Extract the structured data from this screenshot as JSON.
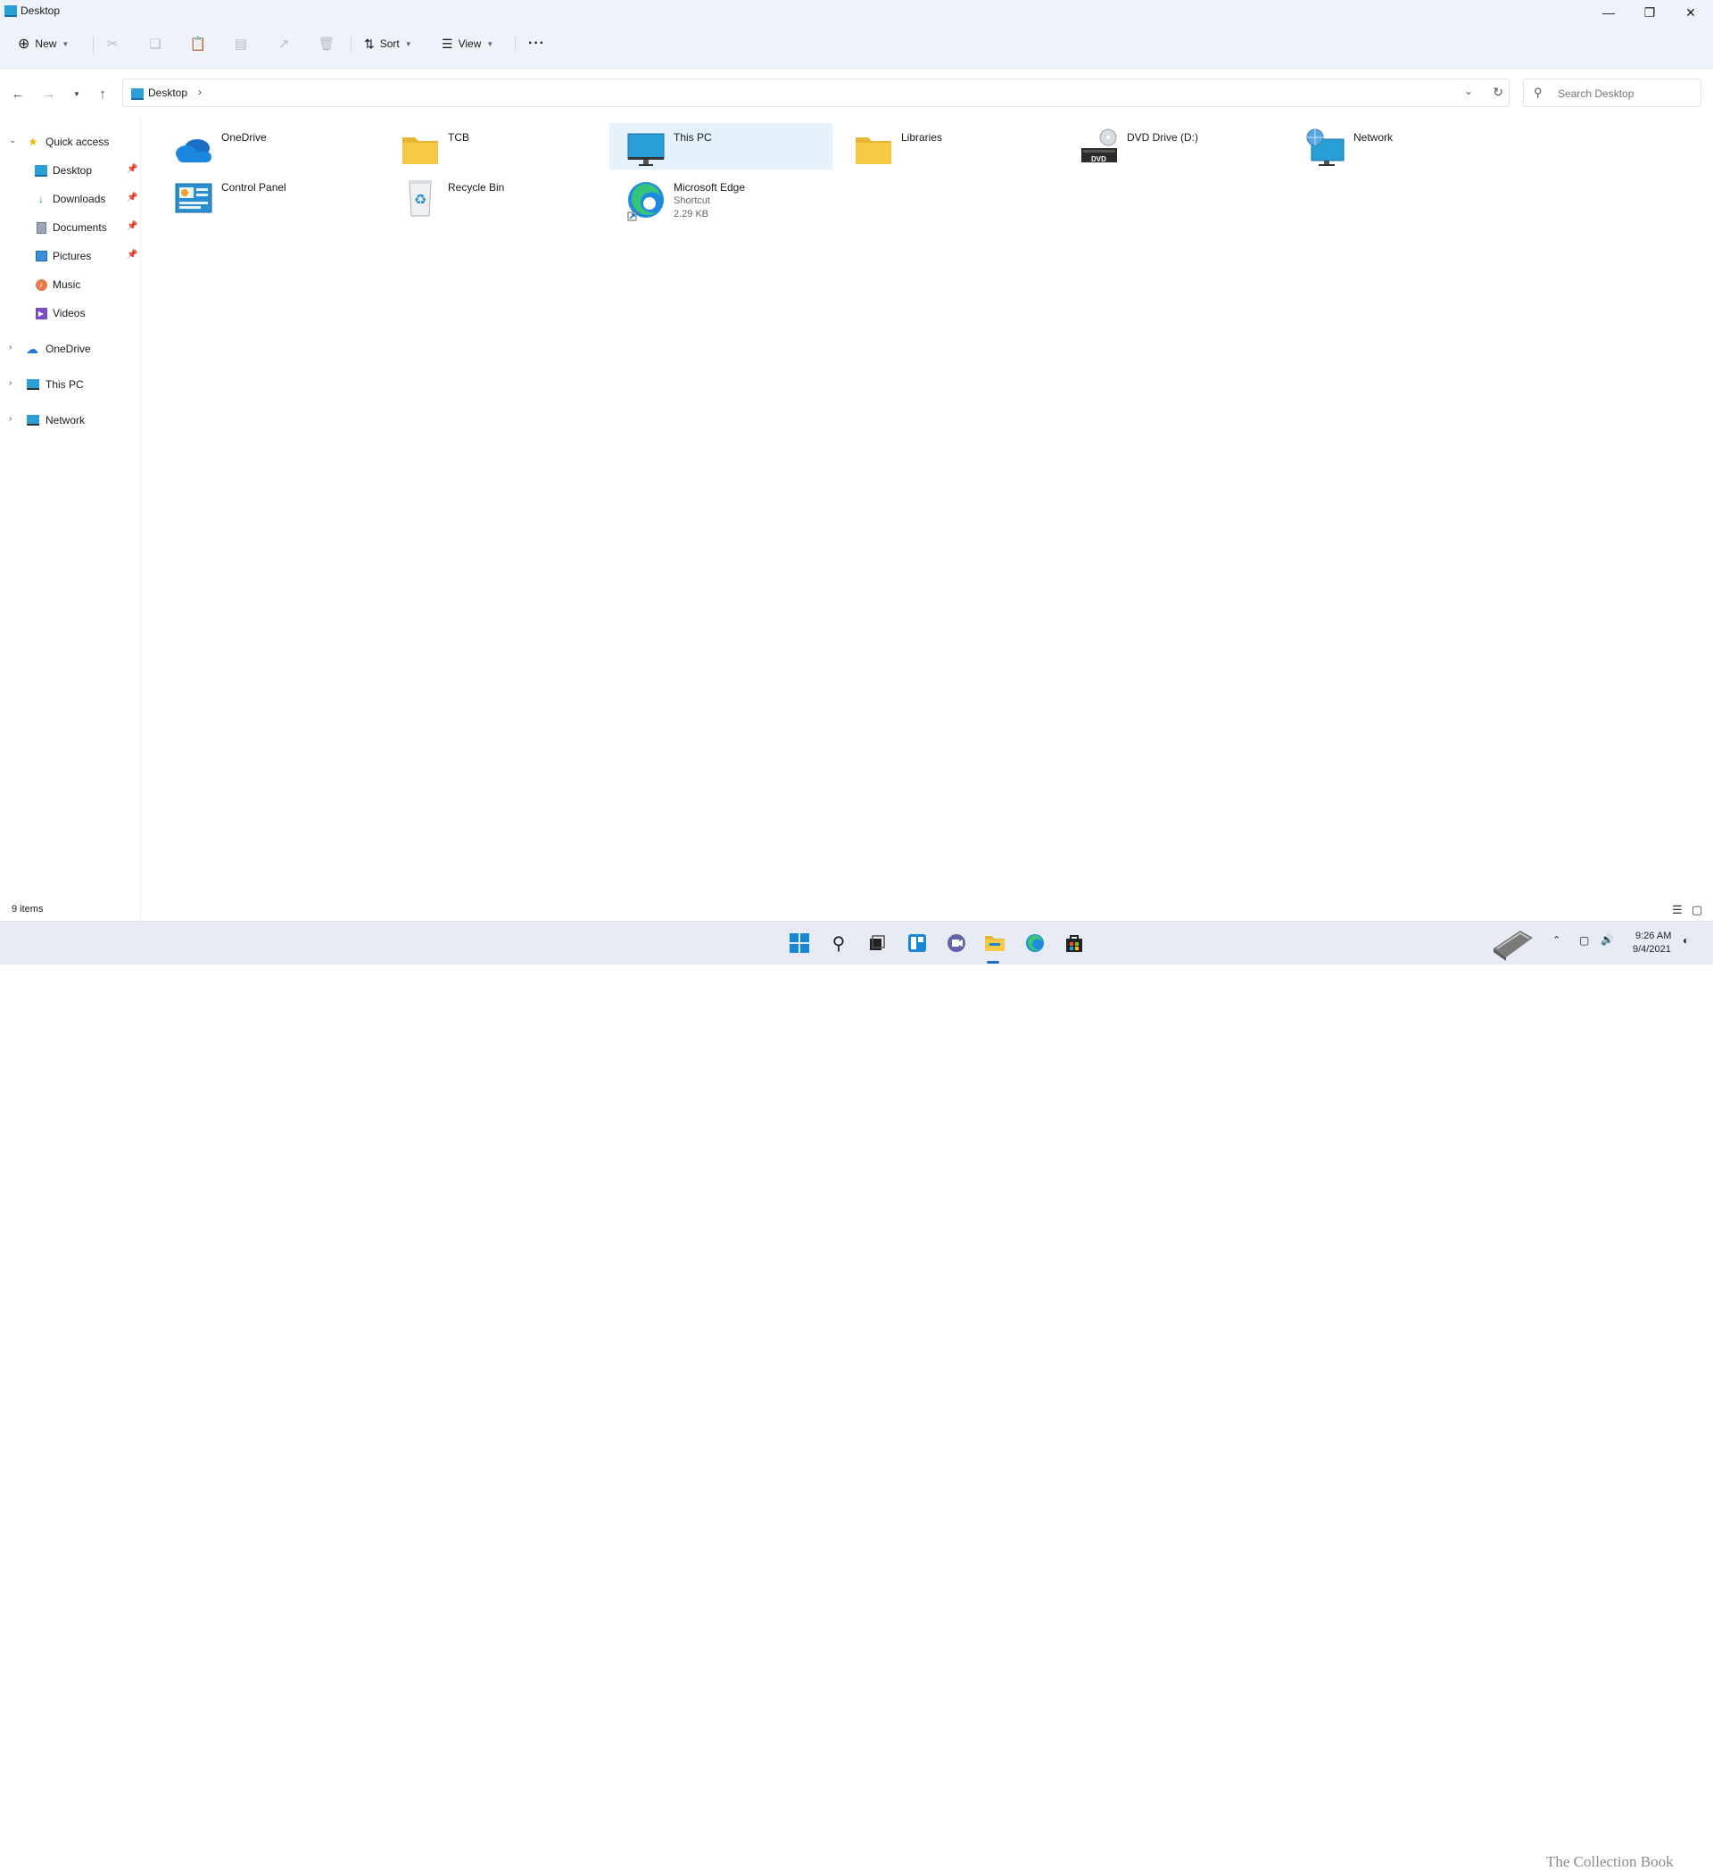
{
  "window": {
    "title": "Desktop"
  },
  "toolbar": {
    "new_label": "New",
    "sort_label": "Sort",
    "view_label": "View",
    "more_label": "···"
  },
  "address": {
    "location": "Desktop",
    "separator": "›"
  },
  "search": {
    "placeholder": "Search Desktop"
  },
  "sidebar": {
    "quick_access": {
      "label": "Quick access",
      "items": [
        {
          "label": "Desktop",
          "icon": "desktop-icon",
          "pinned": true
        },
        {
          "label": "Downloads",
          "icon": "downloads-icon",
          "pinned": true
        },
        {
          "label": "Documents",
          "icon": "documents-icon",
          "pinned": true
        },
        {
          "label": "Pictures",
          "icon": "pictures-icon",
          "pinned": true
        },
        {
          "label": "Music",
          "icon": "music-icon",
          "pinned": false
        },
        {
          "label": "Videos",
          "icon": "videos-icon",
          "pinned": false
        }
      ]
    },
    "roots": [
      {
        "label": "OneDrive",
        "icon": "onedrive-icon"
      },
      {
        "label": "This PC",
        "icon": "this-pc-icon"
      },
      {
        "label": "Network",
        "icon": "network-icon"
      }
    ]
  },
  "content": {
    "items": [
      {
        "name": "OneDrive",
        "icon": "onedrive-cloud-icon"
      },
      {
        "name": "TCB",
        "icon": "folder-icon"
      },
      {
        "name": "This PC",
        "icon": "monitor-icon",
        "selected": true
      },
      {
        "name": "Libraries",
        "icon": "folder-icon"
      },
      {
        "name": "DVD Drive (D:)",
        "icon": "dvd-drive-icon",
        "badge": "DVD"
      },
      {
        "name": "Network",
        "icon": "network-globe-icon"
      },
      {
        "name": "Control Panel",
        "icon": "control-panel-icon"
      },
      {
        "name": "Recycle Bin",
        "icon": "recycle-bin-icon"
      },
      {
        "name": "Microsoft Edge",
        "icon": "edge-icon",
        "type": "Shortcut",
        "size": "2.29 KB"
      }
    ]
  },
  "status": {
    "count": "9 items"
  },
  "tray": {
    "time": "9:26 AM",
    "date": "9/4/2021"
  },
  "watermark": {
    "text": "The Collection Book"
  },
  "colors": {
    "accent": "#1a6fc4",
    "selection": "#e5f1fb",
    "folder": "#f6c945",
    "chrome": "#eef2f9"
  }
}
